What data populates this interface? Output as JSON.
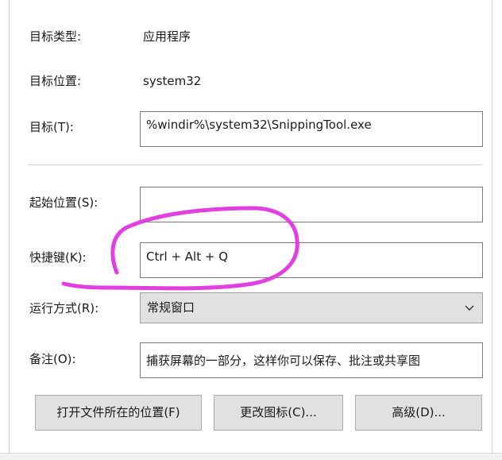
{
  "properties": {
    "target_type_label": "目标类型:",
    "target_type_value": "应用程序",
    "target_location_label": "目标位置:",
    "target_location_value": "system32",
    "target_label": "目标(T):",
    "target_value": "%windir%\\system32\\SnippingTool.exe",
    "start_in_label": "起始位置(S):",
    "start_in_value": "",
    "shortcut_key_label": "快捷键(K):",
    "shortcut_key_value": "Ctrl + Alt + Q",
    "run_label": "运行方式(R):",
    "run_value": "常规窗口",
    "comment_label": "备注(O):",
    "comment_value": "捕获屏幕的一部分，这样你可以保存、批注或共享图"
  },
  "buttons": {
    "open_file_location": "打开文件所在的位置(F)",
    "change_icon": "更改图标(C)...",
    "advanced": "高级(D)..."
  },
  "icons": {
    "run_dropdown": "chevron-down-icon"
  },
  "colors": {
    "annotation": "#e23fe0",
    "button_face": "#e1e1e1",
    "field_border": "#7a7a7a"
  }
}
